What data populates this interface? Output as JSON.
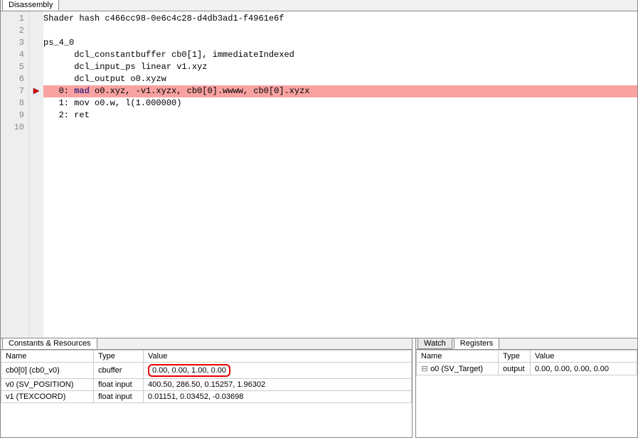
{
  "top_tab": "Disassembly",
  "code": {
    "line1": "Shader hash c466cc98-0e6c4c28-d4db3ad1-f4961e6f",
    "line2": "",
    "line3": "ps_4_0",
    "line4": "      dcl_constantbuffer cb0[1], immediateIndexed",
    "line5": "      dcl_input_ps linear v1.xyz",
    "line6": "      dcl_output o0.xyzw",
    "line7_prefix": "   0: ",
    "line7_kw": "mad",
    "line7_rest": " o0.xyz, -v1.xyzx, cb0[0].wwww, cb0[0].xyzx",
    "line8": "   1: mov o0.w, l(1.000000)",
    "line9": "   2: ret"
  },
  "line_numbers": [
    "1",
    "2",
    "3",
    "4",
    "5",
    "6",
    "7",
    "8",
    "9",
    "10"
  ],
  "constants_title": "Constants & Resources",
  "constants_headers": {
    "name": "Name",
    "type": "Type",
    "value": "Value"
  },
  "constants_rows": [
    {
      "name": "cb0[0] (cb0_v0)",
      "type": "cbuffer",
      "value": "0.00, 0.00, 1.00, 0.00",
      "highlighted": true
    },
    {
      "name": "v0 (SV_POSITION)",
      "type": "float input",
      "value": "400.50, 286.50, 0.15257, 1.96302",
      "highlighted": false
    },
    {
      "name": "v1 (TEXCOORD)",
      "type": "float input",
      "value": "0.01151, 0.03452, -0.03698",
      "highlighted": false
    }
  ],
  "watch_tab": "Watch",
  "registers_tab": "Registers",
  "reg_headers": {
    "name": "Name",
    "type": "Type",
    "value": "Value"
  },
  "reg_rows": [
    {
      "name": "o0 (SV_Target)",
      "type": "output",
      "value": "0.00, 0.00, 0.00, 0.00"
    }
  ]
}
